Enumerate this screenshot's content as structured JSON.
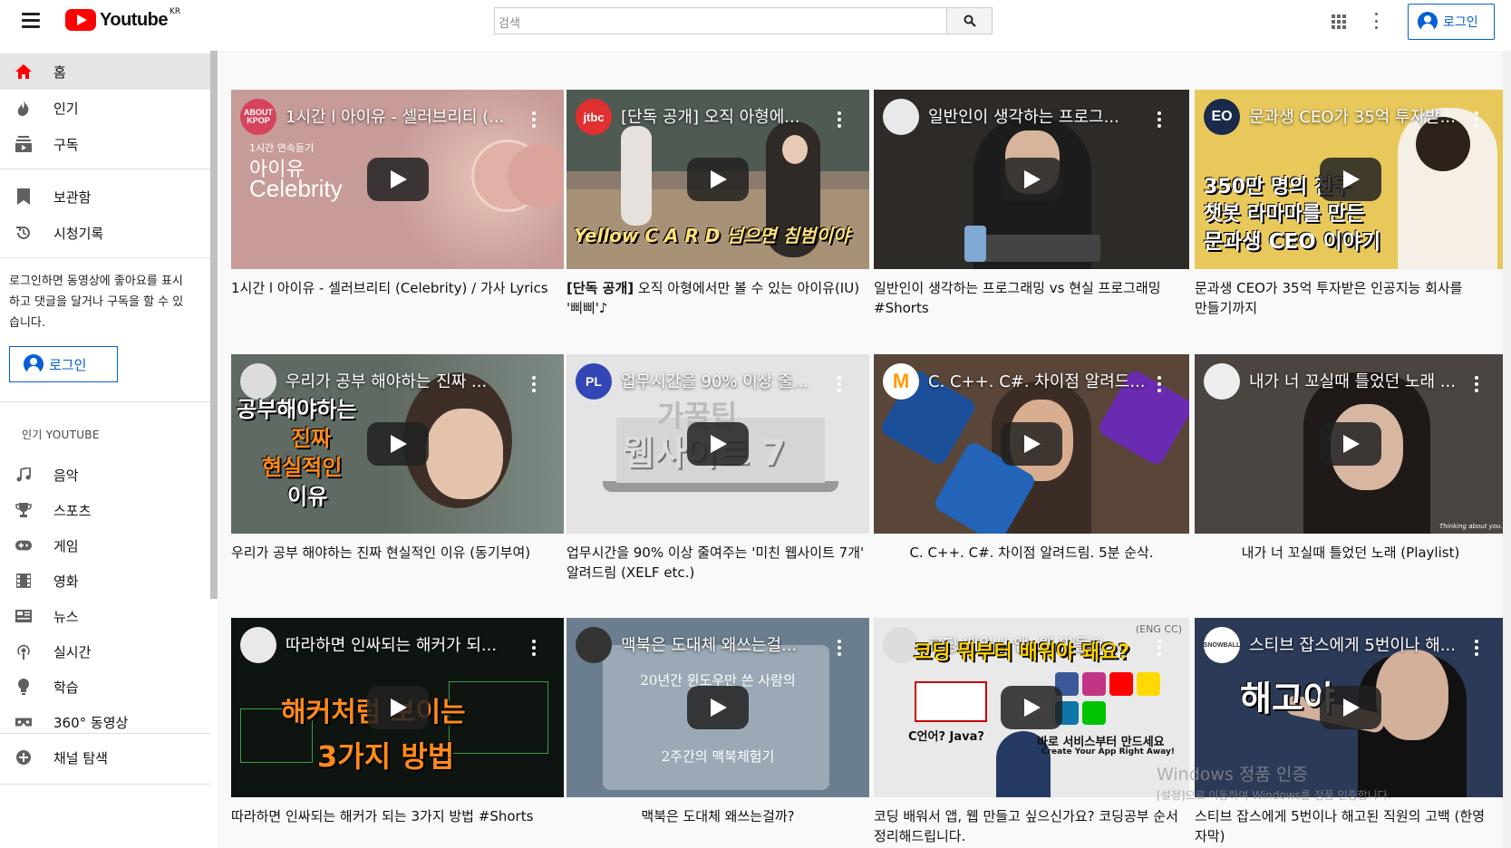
{
  "header": {
    "logo_text": "Youtube",
    "logo_region": "KR",
    "search_placeholder": "검색",
    "login_label": "로그인"
  },
  "sidebar": {
    "items": [
      {
        "label": "홈",
        "icon": "home-icon",
        "active": true
      },
      {
        "label": "인기",
        "icon": "fire-icon"
      },
      {
        "label": "구독",
        "icon": "subscriptions-icon"
      },
      {
        "label": "보관함",
        "icon": "library-icon"
      },
      {
        "label": "시청기록",
        "icon": "history-icon"
      }
    ],
    "login_message": "로그인하면 동영상에 좋아요를 표시하고 댓글을 달거나 구독을 할 수 있습니다.",
    "login_label": "로그인",
    "popular_heading": "인기 YOUTUBE",
    "popular_items": [
      {
        "label": "음악",
        "icon": "music-icon"
      },
      {
        "label": "스포츠",
        "icon": "trophy-icon"
      },
      {
        "label": "게임",
        "icon": "gamepad-icon"
      },
      {
        "label": "영화",
        "icon": "film-icon"
      },
      {
        "label": "뉴스",
        "icon": "news-icon"
      },
      {
        "label": "실시간",
        "icon": "live-icon"
      },
      {
        "label": "학습",
        "icon": "lightbulb-icon"
      },
      {
        "label": "360° 동영상",
        "icon": "vr-icon"
      }
    ],
    "browse_channels": "채널 탐색"
  },
  "videos": [
    {
      "thumb_title": "1시간 l 아이유 - 셀러브리티 (...",
      "caption": "1시간 l 아이유 - 셀러브리티 (Celebrity) / 가사 Lyrics",
      "channel": "ABOUT KPOP",
      "overlay_lines": [
        "1시간 연속듣기",
        "아이유",
        "Celebrity"
      ],
      "bg": "#c79b98"
    },
    {
      "thumb_title": "[단독 공개] 오직 아형에...",
      "caption_bold": "[단독 공개]",
      "caption": " 오직 아형에서만 볼 수 있는 아이유(IU) '삐삐'♪",
      "channel": "jtbc",
      "overlay_lines": [
        "Yellow C A R D 넘으면 침범이야"
      ],
      "bg": "#8a7b6d"
    },
    {
      "thumb_title": "일반인이 생각하는 프로그...",
      "caption": "일반인이 생각하는 프로그래밍 vs 현실 프로그래밍 #Shorts",
      "channel": "",
      "overlay_lines": [],
      "bg": "#2d2a28"
    },
    {
      "thumb_title": "문과생 CEO가 35억 투자받...",
      "caption": "문과생 CEO가 35억 투자받은 인공지능 회사를 만들기까지",
      "channel": "EO",
      "overlay_lines": [
        "350만 명의 친구",
        "챗봇 라마마를 만든",
        "문과생 CEO 이야기"
      ],
      "bg": "#e8c85a"
    },
    {
      "thumb_title": "우리가 공부 해야하는 진짜 ...",
      "caption": "우리가 공부 해야하는 진짜 현실적인 이유 (동기부여)",
      "channel": "",
      "overlay_lines": [
        "공부해야하는",
        "진짜",
        "현실적인",
        "이유"
      ],
      "bg": "#5f6a62"
    },
    {
      "thumb_title": "업무시간을 90% 이상 줄...",
      "caption": "업무시간을 90% 이상 줄여주는 '미친 웹사이트 7개' 알려드림 (XELF etc.)",
      "channel": "PL",
      "overlay_lines": [
        "가꿀팁",
        "웹사이트 7"
      ],
      "bg": "#e4e4e4"
    },
    {
      "thumb_title": "C. C++. C#. 차이점 알려드...",
      "caption": "C. C++. C#. 차이점 알려드림. 5분 순삭.",
      "channel": "",
      "overlay_lines": [],
      "bg": "#5a4638"
    },
    {
      "thumb_title": "내가 너 꼬실때 틀었던 노래 ...",
      "caption": "내가 너 꼬실때 틀었던 노래 (Playlist)",
      "channel": "",
      "overlay_lines": [
        "Thinking about you."
      ],
      "bg": "#4a4540"
    },
    {
      "thumb_title": "따라하면 인싸되는 해커가 되...",
      "caption": "따라하면 인싸되는 해커가 되는 3가지 방법 #Shorts",
      "channel": "",
      "overlay_lines": [
        "해커처럼 보이는",
        "3가지 방법"
      ],
      "bg": "#0e1410"
    },
    {
      "thumb_title": "맥북은 도대체 왜쓰는걸...",
      "caption": "맥북은 도대체 왜쓰는걸까?",
      "channel": "",
      "overlay_lines": [
        "20년간 윈도우만 쓴 사람의",
        "2주간의 맥북체험기"
      ],
      "bg": "#6b7e8f"
    },
    {
      "thumb_title": "코딩 배워서 앱, 웹 만들고 ...",
      "caption": "코딩 배워서 앱, 웹 만들고 싶으신가요? 코딩공부 순서 정리해드립니다.",
      "channel": "",
      "overlay_lines": [
        "코딩 뭐부터 배워야 돼요?",
        "C언어? Java?",
        "바로 서비스부터 만드세요",
        "Create Your App Right Away!"
      ],
      "tag": "(ENG CC)",
      "bg": "#e9e9e9"
    },
    {
      "thumb_title": "스티브 잡스에게 5번이나 해...",
      "caption": "스티브 잡스에게 5번이나 해고된 직원의 고백 (한영 자막)",
      "channel": "SNOWBALL",
      "overlay_lines": [
        "해고야"
      ],
      "bg": "#2b3a57"
    }
  ],
  "watermark": {
    "line1": "Windows 정품 인증",
    "line2": "[설정]으로 이동하여 Windows를 정품 인증합니다."
  }
}
